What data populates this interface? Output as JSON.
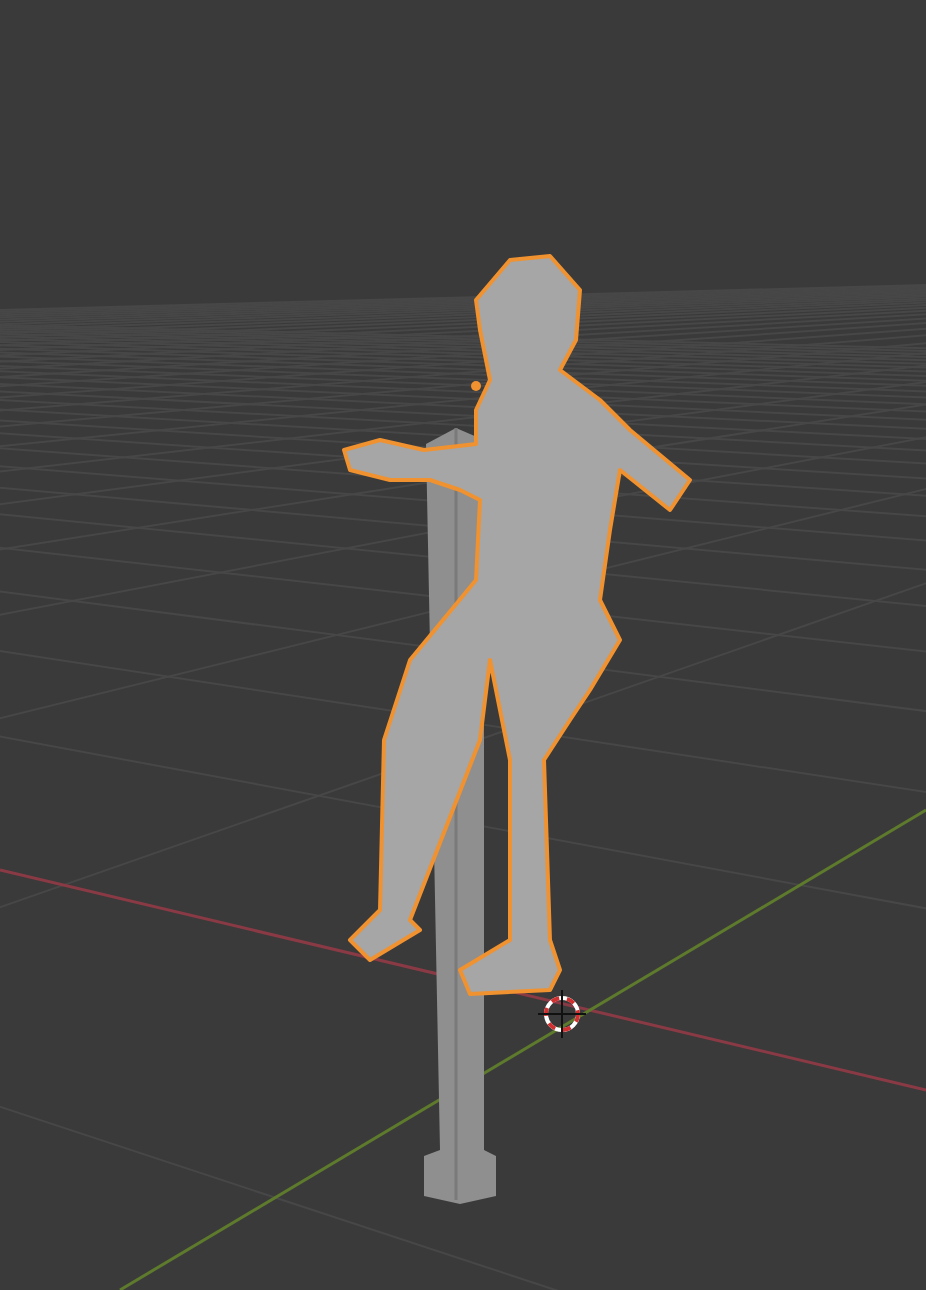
{
  "viewport": {
    "figure": {
      "selected": true
    },
    "pole": {
      "selected": false
    }
  }
}
